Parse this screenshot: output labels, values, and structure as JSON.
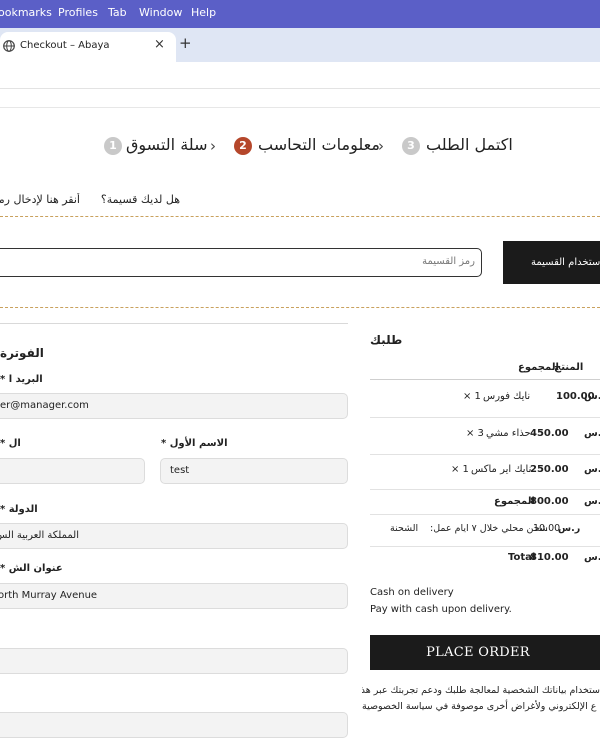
{
  "menubar": {
    "items": [
      "ookmarks",
      "Profiles",
      "Tab",
      "Window",
      "Help"
    ]
  },
  "tab": {
    "title": "Checkout – Abaya",
    "close": "×",
    "new_tab": "+"
  },
  "steps": {
    "step1_label": "سلة التسوق",
    "step1_num": "1",
    "step2_label": "معلومات التحاسب",
    "step2_num": "2",
    "step3_label": "اكتمل الطلب",
    "step3_num": "3",
    "chevron": "›"
  },
  "coupon": {
    "question": "هل لديك قسيمة؟",
    "link": "أنقر هنا لإدخال رمز",
    "placeholder": "رمز القسيمة",
    "apply_label": "استخدام القسيمة"
  },
  "billing": {
    "title": "الفوترة",
    "email_label": "البريد ا *",
    "email_value": "er@manager.com",
    "last_name_label": "ال *",
    "last_name_value": "",
    "first_name_label": "الاسم الأول *",
    "first_name_value": "test",
    "country_label": "الدولة *",
    "country_value": "المملكة العربية الس",
    "address_label": "عنوان الش *",
    "address_value": "orth Murray Avenue",
    "extra_field_value": ""
  },
  "order": {
    "title": "طلبك",
    "col_product": "المنتج",
    "col_total": "المجموع",
    "items": [
      {
        "name": "نايك فورس",
        "qty": "× 1",
        "price": "100.00",
        "currency": "ر.س"
      },
      {
        "name": "حذاء مشي",
        "qty": "× 3",
        "price": "450.00",
        "currency": "ر.س"
      },
      {
        "name": "نايك اير ماكس",
        "qty": "× 1",
        "price": "250.00",
        "currency": "ر.س"
      }
    ],
    "subtotal_label": "المجموع",
    "subtotal_value": "800.00",
    "shipping_label": "الشحنة",
    "shipping_text": "شحن محلي خلال ٧ ايام عمل:",
    "shipping_value": "10.00",
    "total_label": "Total",
    "total_value": "810.00",
    "currency": "ر.س",
    "payment_title": "Cash on delivery",
    "payment_desc": "Pay with cash upon delivery.",
    "place_order_label": "PLACE ORDER",
    "privacy_line1": "ستخدام بياناتك الشخصية لمعالجة طلبك ودعم تجربتك عبر هذا",
    "privacy_line2": "ع الإلكتروني ولأغراض أخرى موصوفة في سياسة الخصوصية"
  },
  "colors": {
    "menubar": "#5b5fc7",
    "active_step": "#b5472b",
    "dashed": "#c9a15d",
    "button": "#1b1b1b"
  }
}
